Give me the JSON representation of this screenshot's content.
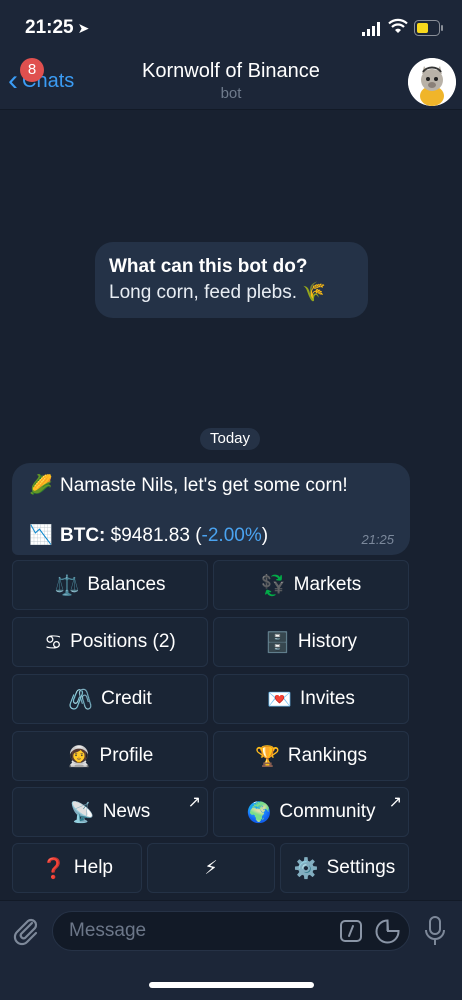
{
  "status": {
    "time": "21:25"
  },
  "nav": {
    "back_label": "Chats",
    "badge_count": "8",
    "title": "Kornwolf of Binance",
    "subtitle": "bot"
  },
  "info": {
    "title": "What can this bot do?",
    "text": "Long corn, feed plebs. 🌾"
  },
  "date_separator": "Today",
  "message": {
    "greeting_emoji": "🌽",
    "greeting": "Namaste Nils, let's get some corn!",
    "chart_emoji": "📉",
    "btc_label": "BTC:",
    "btc_price": "$9481.83 (",
    "btc_change": "-2.00%",
    "btc_close": ")",
    "time": "21:25"
  },
  "keyboard": {
    "balances": {
      "icon": "⚖️",
      "label": "Balances"
    },
    "markets": {
      "icon": "💱",
      "label": "Markets"
    },
    "positions": {
      "icon": "♋",
      "label": "Positions (2)"
    },
    "history": {
      "icon": "🗄️",
      "label": "History"
    },
    "credit": {
      "icon": "🖇️",
      "label": "Credit"
    },
    "invites": {
      "icon": "💌",
      "label": "Invites"
    },
    "profile": {
      "icon": "👩‍🚀",
      "label": "Profile"
    },
    "rankings": {
      "icon": "🏆",
      "label": "Rankings"
    },
    "news": {
      "icon": "📡",
      "label": "News",
      "ext": "↗"
    },
    "community": {
      "icon": "🌍",
      "label": "Community",
      "ext": "↗"
    },
    "help": {
      "icon": "❓",
      "label": "Help"
    },
    "flash": {
      "icon": "⚡"
    },
    "settings": {
      "icon": "⚙️",
      "label": "Settings"
    }
  },
  "composer": {
    "placeholder": "Message"
  }
}
